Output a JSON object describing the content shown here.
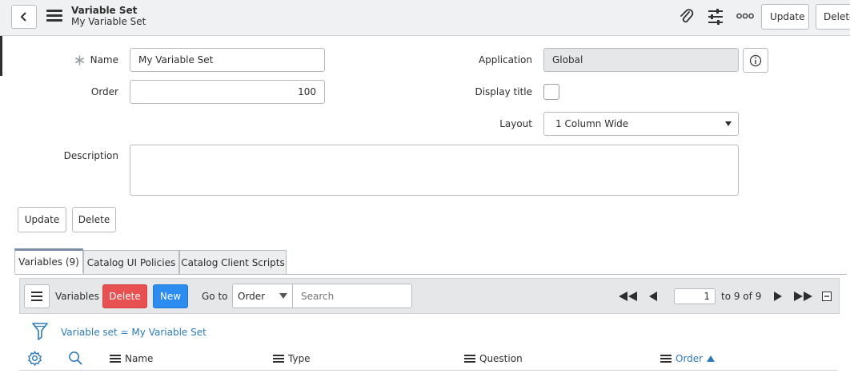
{
  "header": {
    "title": "Variable Set",
    "subtitle": "My Variable Set",
    "update_label": "Update",
    "delete_label": "Delete"
  },
  "icons": {
    "back": "chevron-left-icon",
    "menu": "hamburger-icon",
    "attach": "paperclip-icon",
    "personalize": "sliders-icon",
    "more": "more-options-icon",
    "info": "info-icon",
    "filter": "funnel-icon",
    "settings": "gear-icon",
    "search": "search-icon"
  },
  "form": {
    "name_label": "Name",
    "name_value": "My Variable Set",
    "order_label": "Order",
    "order_value": "100",
    "application_label": "Application",
    "application_value": "Global",
    "display_title_label": "Display title",
    "layout_label": "Layout",
    "layout_value": "1 Column Wide",
    "description_label": "Description",
    "description_value": "",
    "update_label": "Update",
    "delete_label": "Delete"
  },
  "tabs": [
    {
      "label": "Variables (9)",
      "active": true
    },
    {
      "label": "Catalog UI Policies",
      "active": false
    },
    {
      "label": "Catalog Client Scripts",
      "active": false
    }
  ],
  "related_list": {
    "title": "Variables",
    "delete_label": "Delete",
    "new_label": "New",
    "goto_label": "Go to",
    "goto_field": "Order",
    "search_placeholder": "Search",
    "page_value": "1",
    "page_range": "to 9 of 9",
    "filter_text": "Variable set = My Variable Set",
    "columns": [
      {
        "label": "Name",
        "sorted": false
      },
      {
        "label": "Type",
        "sorted": false
      },
      {
        "label": "Question",
        "sorted": false
      },
      {
        "label": "Order",
        "sorted": true,
        "direction": "asc"
      }
    ]
  },
  "colors": {
    "delete_bg": "#e85151",
    "new_bg": "#2d8cf0",
    "link": "#2c7ab9"
  }
}
